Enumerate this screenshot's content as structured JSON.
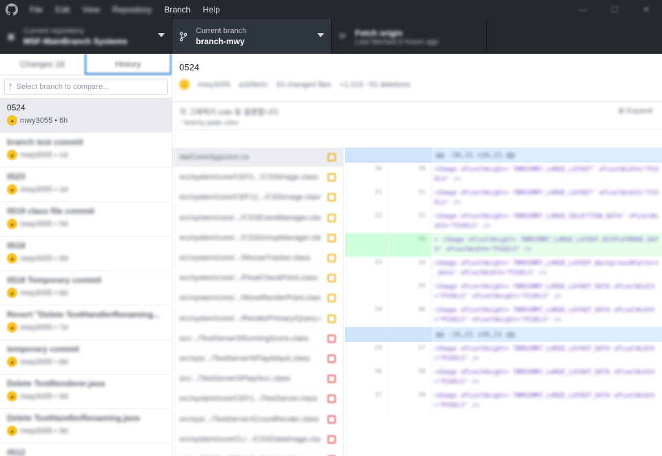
{
  "titlebar": {
    "menu": [
      "File",
      "Edit",
      "View",
      "Repository",
      "Branch",
      "Help"
    ],
    "window_controls": [
      "—",
      "☐",
      "✕"
    ]
  },
  "toolbar": {
    "repo": {
      "label": "Current repository",
      "name": "MSF-MainBranch Systems"
    },
    "branch": {
      "label": "Current branch",
      "name": "branch-mwy"
    },
    "fetch": {
      "label": "Fetch origin",
      "sub": "Last fetched 6 hours ago"
    }
  },
  "sidebar": {
    "tabs": [
      "Changes 18",
      "History"
    ],
    "compare_placeholder": "Select branch to compare...",
    "commits": [
      {
        "summary": "0524",
        "author": "mwy3055 • 6h",
        "selected": true,
        "dim": false
      },
      {
        "summary": "branch test commit",
        "author": "mwy3055 • 1d",
        "selected": false,
        "dim": true
      },
      {
        "summary": "0523",
        "author": "mwy3055 • 1d",
        "selected": false,
        "dim": true
      },
      {
        "summary": "0519 class file commit",
        "author": "mwy3055 • 5d",
        "selected": false,
        "dim": true
      },
      {
        "summary": "0518",
        "author": "mwy3055 • 6d",
        "selected": false,
        "dim": true
      },
      {
        "summary": "0518 Temporary commit",
        "author": "mwy3055 • 6d",
        "selected": false,
        "dim": true
      },
      {
        "summary": "Revert \"Delete TestHandlerRenaming...",
        "author": "mwy3055 • 7d",
        "selected": false,
        "dim": true
      },
      {
        "summary": "temporary commit",
        "author": "mwy3055 • 8d",
        "selected": false,
        "dim": true
      },
      {
        "summary": "Delete TestRenderer.java",
        "author": "mwy3055 • 9d",
        "selected": false,
        "dim": true
      },
      {
        "summary": "Delete TestHandlerRenaming.java",
        "author": "mwy3055 • 9d",
        "selected": false,
        "dim": true
      },
      {
        "summary": "0512",
        "author": "mwy3055 • 12d",
        "selected": false,
        "dim": true
      }
    ]
  },
  "main": {
    "commit_title": "0524",
    "commit_meta": [
      "mwy3055",
      "a1b9e0c",
      "43 changed files",
      "+1,019 −91 deletions"
    ],
    "description_l1": "각 그래픽이 colo 등 설명합니다",
    "description_l2": "- Notchy plate color",
    "expand_label": "Expand",
    "files": [
      {
        "name": "Ab/Core/Appconn.cs",
        "status": "modified"
      },
      {
        "name": "src/system/core/CEF1.../CSSImage.class",
        "status": "modified"
      },
      {
        "name": "src/system/core/CEF12.../CSSImage.class",
        "status": "modified"
      },
      {
        "name": "src/system/core/.../CSSEventManager.class",
        "status": "modified"
      },
      {
        "name": "src/system/core/.../CSSGroupManager.class",
        "status": "modified"
      },
      {
        "name": "src/system/core/.../MouseTracker.class",
        "status": "modified"
      },
      {
        "name": "src/system/core/.../FloatCheckPoint.class",
        "status": "modified"
      },
      {
        "name": "src/system/core/.../MoveRenderPoint.class",
        "status": "modified"
      },
      {
        "name": "src/system/core/.../RenderPrimary/Query.class",
        "status": "modified"
      },
      {
        "name": "src/.../TestServerSRunningScore.class",
        "status": "deleted"
      },
      {
        "name": "src/sys/.../TestServerSPlayAttack.class",
        "status": "deleted"
      },
      {
        "name": "src/.../TestServerSPlay/Acc.class",
        "status": "deleted"
      },
      {
        "name": "src/system/core/CEF1.../TestServer.class",
        "status": "deleted"
      },
      {
        "name": "src/sys/.../TestServerSCountRender.class",
        "status": "deleted"
      },
      {
        "name": "src/system/core/CL/.../CSSDataImage.class",
        "status": "deleted"
      },
      {
        "name": "src/.../CSSCreditCard/.../Image.class",
        "status": "deleted"
      }
    ],
    "diff": {
      "hunk1": "@@ -26,21 +26,21 @@",
      "hunk2": "@@ -26,21 +26,21 @@",
      "lines": [
        {
          "old": "30",
          "new": "30",
          "code": "<Image xPixelHeight= TBMSSMM7_LARGE_LAYOUT\" xPixelWidth=\"PIXELS\" />",
          "added": false
        },
        {
          "old": "31",
          "new": "31",
          "code": "<Image xPixelHeight= TBMSSMM7_LARGE_LAYOUT\" xPixelWidth=\"PIXELS\" />",
          "added": false
        },
        {
          "old": "32",
          "new": "32",
          "code": "<Image xPixelHeight= TBMSSMM7_LARGE_SELECTION_DATA\" xPixelWidth=\"PIXELS\" />",
          "added": false
        },
        {
          "old": "",
          "new": "33",
          "code": "+ <Image xPixelHeight= TBMSSMM7_LARGE_LAYOUT_DISPLAYMODE_DATA\" xPixelWidth=\"PIXELS\" />",
          "added": true
        },
        {
          "old": "33",
          "new": "34",
          "code": "<Image xPixelHeight= TBMSSMM7_LARGE_LAYOUT_BackgroundPattern_data\" xPixelWidth=\"PIXELS\" />",
          "added": false
        },
        {
          "old": "",
          "new": "35",
          "code": "<Image xPixelHeight= TBMSSMM7_LARGE_LAYOUT_DATA xPixelWidth=\"PIXELS\" xPixelHeight=\"PIXELS\" />",
          "added": false
        },
        {
          "old": "34",
          "new": "36",
          "code": "<Image xPixelHeight= TBMSSMM7_LARGE_LAYOUT_DATA xPixelWidth=\"PIXELS\" xPixelHeight=\"PIXELS\" />",
          "added": false
        }
      ],
      "lines2": [
        {
          "old": "35",
          "new": "37",
          "code": "<Image xPixelHeight= TBMSSMM7_LARGE_LAYOUT_DATA xPixelWidth=\"PIXELS\" />",
          "added": false
        },
        {
          "old": "36",
          "new": "38",
          "code": "<Image xPixelHeight= TBMSSMM7_LARGE_LAYOUT_DATA xPixelWidth=\"PIXELS\" />",
          "added": false
        },
        {
          "old": "37",
          "new": "39",
          "code": "<Image xPixelHeight= TBMSSMM7_LARGE_LAYOUT_DATA xPixelWidth=\"PIXELS\" />",
          "added": false
        }
      ]
    }
  }
}
